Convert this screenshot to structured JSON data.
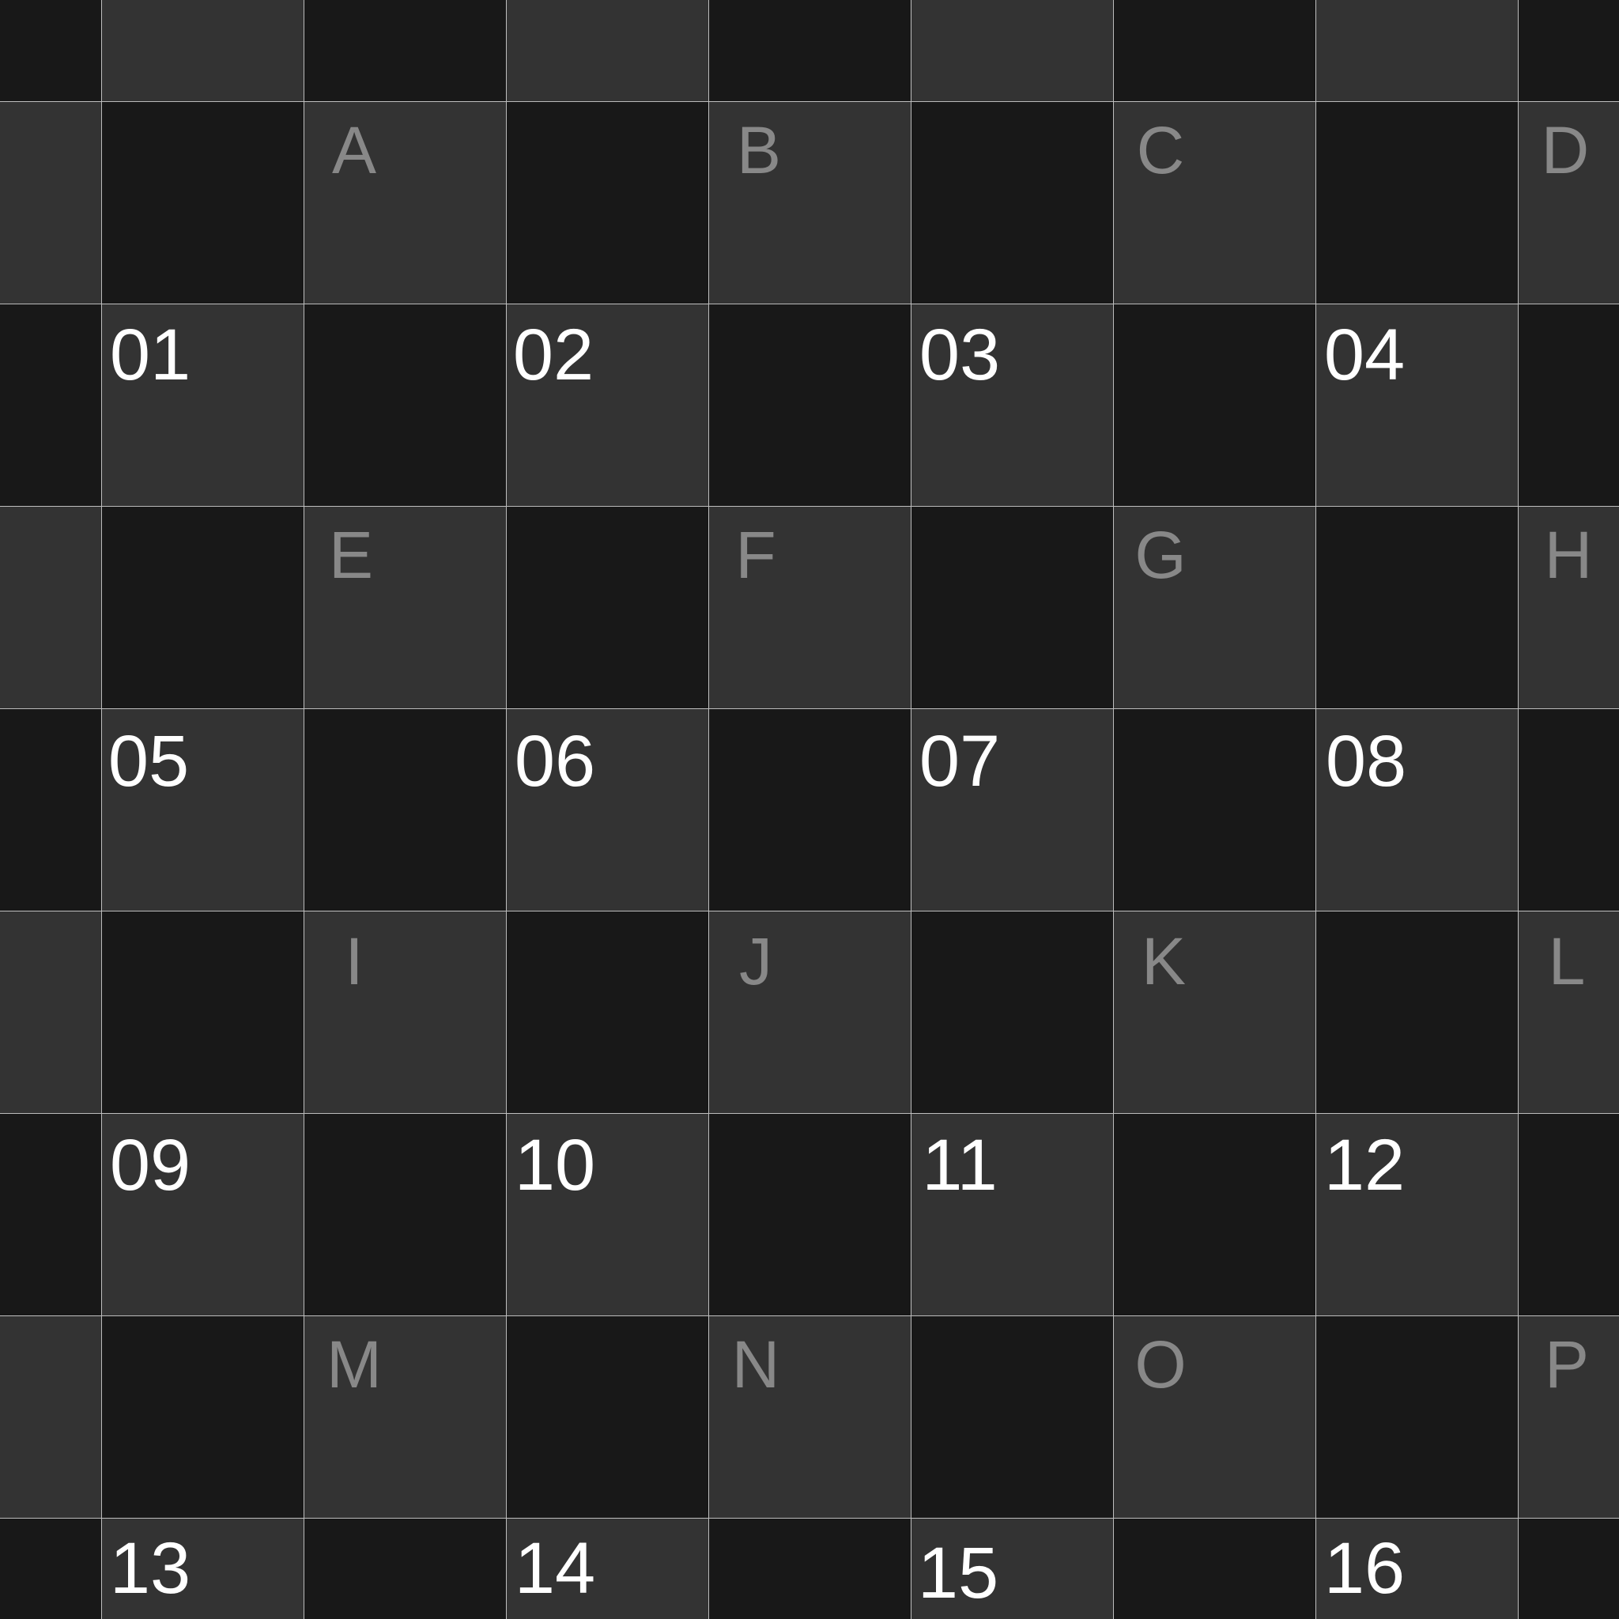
{
  "colors": {
    "dark_cell": "#181818",
    "light_cell": "#333333",
    "grid_line": "#d8d8d8",
    "letter_color": "#888888",
    "number_color": "#ffffff"
  },
  "letters": [
    "A",
    "B",
    "C",
    "D",
    "E",
    "F",
    "G",
    "H",
    "I",
    "J",
    "K",
    "L",
    "M",
    "N",
    "O",
    "P"
  ],
  "numbers": [
    "01",
    "02",
    "03",
    "04",
    "05",
    "06",
    "07",
    "08",
    "09",
    "10",
    "11",
    "12",
    "13",
    "14",
    "15",
    "16"
  ]
}
